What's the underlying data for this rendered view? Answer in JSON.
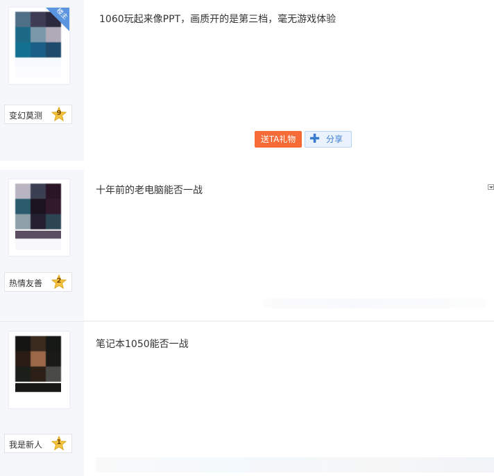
{
  "posts": [
    {
      "badge": "楼主",
      "level_name": "变幻莫测",
      "level": "9",
      "content": "1060玩起来像PPT，画质开的是第三档，毫无游戏体验",
      "gift_button": "送TA礼物",
      "share_button": "分享"
    },
    {
      "level_name": "热情友善",
      "level": "2",
      "content": "十年前的老电脑能否一战"
    },
    {
      "level_name": "我是新人",
      "level": "1",
      "content": "笔记本1050能否一战"
    }
  ],
  "colors": {
    "gift_button": "#f76b36",
    "badge": "#5b95e0",
    "share_text": "#3a7dd0"
  },
  "icons": [
    "star-level-icon",
    "plus-icon",
    "dropdown-icon"
  ]
}
